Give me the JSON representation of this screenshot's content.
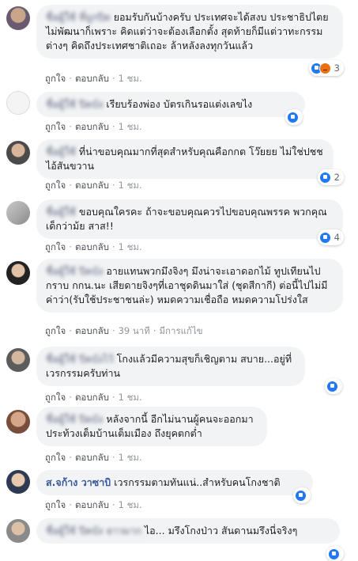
{
  "action_labels": {
    "like": "ถูกใจ",
    "reply": "ตอบกลับ",
    "sep": "·"
  },
  "comments": [
    {
      "author": "ชื่อผู้ใช้ ที่ถูกปิด",
      "text": "ยอมรับกันบ้างครับ ประเทศจะได้สงบ ประชาธิปไตย ไม่พัฒนาก็เพราะ คิดแต่ว่าจะต้องเลือกตั้ง สุดท้ายก็มีแต่วาทะกรรมต่างๆ คิดถึงประเทศชาติเถอะ ล้าหลังลงทุกวันแล้ว",
      "time": "1 ชม.",
      "reactions": {
        "icons": [
          "like-icon",
          "angry-icon"
        ],
        "count": "3"
      }
    },
    {
      "author": "ชื่อผู้ใช้ ปิดบัง",
      "text": "เรียบร้องพ่อง บัตรเกินรอแต่งเลขไง",
      "time": "1 ชม.",
      "reactions": {
        "icons": [
          "like-icon"
        ],
        "count": ""
      }
    },
    {
      "author": "ชื่อผู้ใช้",
      "text": "ที่น่าขอบคุณมากที่สุดสำหรับคุณคือกกต โว๊ยยย ไม่ใช่ปชช ไอ้สันขวาน",
      "time": "1 ชม.",
      "reactions": {
        "icons": [
          "like-icon"
        ],
        "count": "2"
      }
    },
    {
      "author": "ชื่อผู้ใช้",
      "text": "ขอบคุณใครคะ ถ้าจะขอบคุณควรไปขอบคุณพรรค พวกคุณเด็กว่าม้ย สาส!!",
      "time": "1 ชม.",
      "reactions": {
        "icons": [
          "like-icon"
        ],
        "count": "4"
      }
    },
    {
      "author": "ชื่อผู้ใช้ ปิดบัง",
      "text": "อายแทนพวกมึงจิงๆ มึงน่าจะเอาดอกไม้ ทูปเทียนไปกราบ กกน.นะ เสียดายจิงๆที่เอาชุดดินมาใส่ (ชุดสีกากี) ต่อนี้ไปไม่มีค่าว่า(รับใช้ประชาชนล่ะ) หมดความเชื่อถือ หมดความโปร่งใส",
      "time": "39 นาที",
      "edited": "มีการแก้ไข",
      "reactions": null
    },
    {
      "author": "ชื่อผู้ใช้ ปิดบังไว้",
      "text": "โกงแล้วมีความสุขก็เชิญตาม สบาย...อยู่ที่เวรกรรมครับท่าน",
      "time": "1 ชม.",
      "reactions": {
        "icons": [
          "like-icon"
        ],
        "count": ""
      }
    },
    {
      "author": "ชื่อผู้ใช้ ปิดบัง",
      "text": "หลังจากนี้ อีกไม่นานผู้คนจะออกมา ประท้วงเต็มบ้านเต็มเมือง ถึงยุคตกต่ำ",
      "time": "1 ชม.",
      "reactions": null
    },
    {
      "author": "ส.จก้าง วาซาบิ",
      "text": "เวรกรรมตามทันแน่..สำหรับคนโกงชาติ",
      "time": "1 ชม.",
      "reactions": {
        "icons": [
          "like-icon"
        ],
        "count": ""
      }
    },
    {
      "author": "ชื่อผู้ใช้ ปิดบัง ยาวมาก",
      "text": "ไอ... มรึงโกงป่าว สันดานมรึงนี่จริงๆ",
      "time": "",
      "reactions": {
        "icons": [
          "like-icon"
        ],
        "count": ""
      }
    }
  ]
}
